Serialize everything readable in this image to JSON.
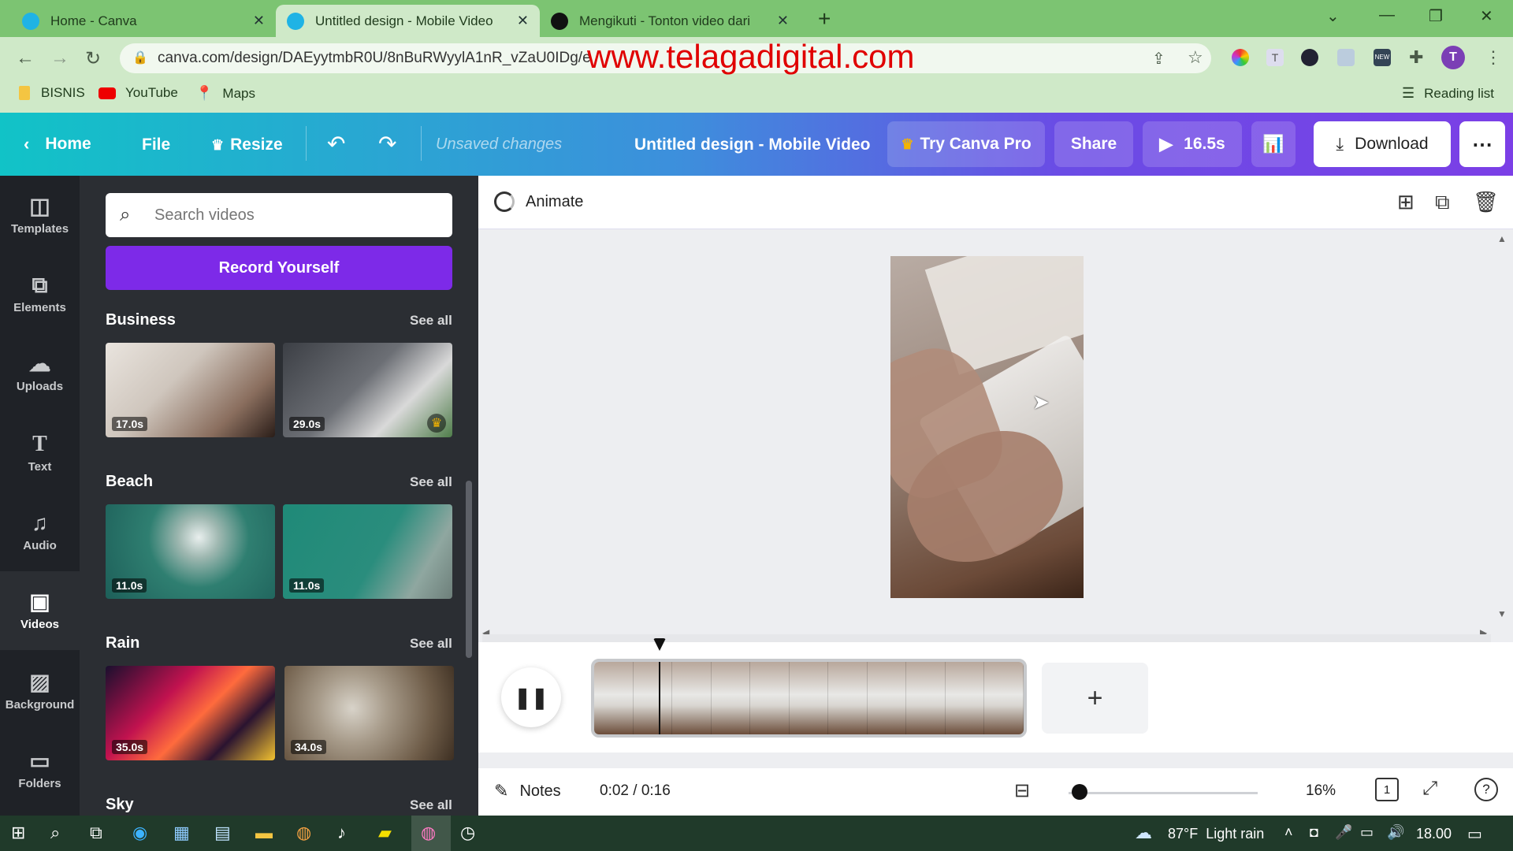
{
  "browser": {
    "tabs": [
      {
        "title": "Home - Canva",
        "icon_color": "#1fb3e5"
      },
      {
        "title": "Untitled design - Mobile Video",
        "icon_color": "#1fb3e5"
      },
      {
        "title": "Mengikuti - Tonton video dari kr…",
        "icon_color": "#111111"
      }
    ],
    "url": "canva.com/design/DAEyytmbR0U/8nBuRWyylA1nR_vZaU0IDg/e",
    "overlay_text": "www.telagadigital.com",
    "bookmarks": [
      "BISNIS",
      "YouTube",
      "Maps"
    ],
    "reading_list": "Reading list",
    "profile_initial": "T"
  },
  "canva_header": {
    "home": "Home",
    "file": "File",
    "resize": "Resize",
    "status": "Unsaved changes",
    "design_title": "Untitled design - Mobile Video",
    "try_pro": "Try Canva Pro",
    "share": "Share",
    "play_duration": "16.5s",
    "download": "Download"
  },
  "sidebar": {
    "items": [
      {
        "label": "Templates",
        "icon": "templates-icon"
      },
      {
        "label": "Elements",
        "icon": "elements-icon"
      },
      {
        "label": "Uploads",
        "icon": "uploads-icon"
      },
      {
        "label": "Text",
        "icon": "text-icon"
      },
      {
        "label": "Audio",
        "icon": "audio-icon"
      },
      {
        "label": "Videos",
        "icon": "videos-icon"
      },
      {
        "label": "Background",
        "icon": "background-icon"
      },
      {
        "label": "Folders",
        "icon": "folders-icon"
      }
    ],
    "active": "Videos"
  },
  "panel": {
    "search_placeholder": "Search videos",
    "record_button": "Record Yourself",
    "see_all": "See all",
    "sections": [
      {
        "title": "Business",
        "videos": [
          {
            "duration": "17.0s"
          },
          {
            "duration": "29.0s",
            "pro": true
          }
        ]
      },
      {
        "title": "Beach",
        "videos": [
          {
            "duration": "11.0s"
          },
          {
            "duration": "11.0s"
          }
        ]
      },
      {
        "title": "Rain",
        "videos": [
          {
            "duration": "35.0s"
          },
          {
            "duration": "34.0s"
          }
        ]
      },
      {
        "title": "Sky",
        "videos": []
      }
    ]
  },
  "editor": {
    "animate": "Animate",
    "notes": "Notes",
    "time": "0:02 / 0:16",
    "zoom": "16%",
    "page_number": "1",
    "zoom_level": 0.06
  },
  "taskbar": {
    "weather": "87°F  Light rain",
    "clock": "18.00"
  }
}
